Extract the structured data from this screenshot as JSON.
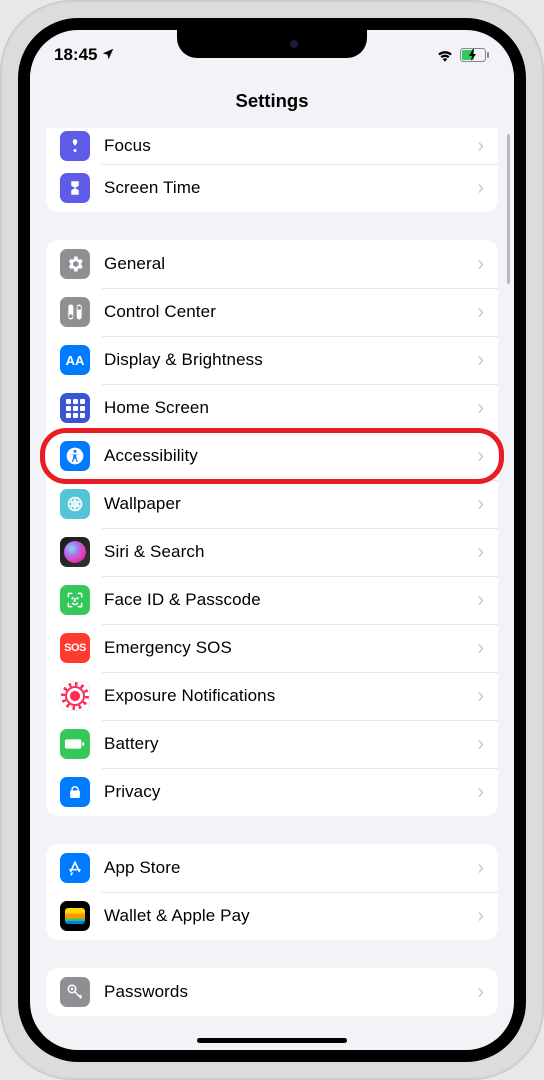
{
  "status": {
    "time": "18:45"
  },
  "header": {
    "title": "Settings"
  },
  "groups": [
    {
      "rows": [
        {
          "key": "focus",
          "label": "Focus",
          "icon": "focus-icon"
        },
        {
          "key": "screentime",
          "label": "Screen Time",
          "icon": "screen-time-icon"
        }
      ]
    },
    {
      "rows": [
        {
          "key": "general",
          "label": "General",
          "icon": "general-icon"
        },
        {
          "key": "controlcenter",
          "label": "Control Center",
          "icon": "control-center-icon"
        },
        {
          "key": "display",
          "label": "Display & Brightness",
          "icon": "display-brightness-icon"
        },
        {
          "key": "homescreen",
          "label": "Home Screen",
          "icon": "home-screen-icon"
        },
        {
          "key": "accessibility",
          "label": "Accessibility",
          "icon": "accessibility-icon",
          "highlighted": true
        },
        {
          "key": "wallpaper",
          "label": "Wallpaper",
          "icon": "wallpaper-icon"
        },
        {
          "key": "siri",
          "label": "Siri & Search",
          "icon": "siri-icon"
        },
        {
          "key": "faceid",
          "label": "Face ID & Passcode",
          "icon": "face-id-icon"
        },
        {
          "key": "sos",
          "label": "Emergency SOS",
          "icon": "sos-icon"
        },
        {
          "key": "exposure",
          "label": "Exposure Notifications",
          "icon": "exposure-notifications-icon"
        },
        {
          "key": "battery",
          "label": "Battery",
          "icon": "battery-icon"
        },
        {
          "key": "privacy",
          "label": "Privacy",
          "icon": "privacy-icon"
        }
      ]
    },
    {
      "rows": [
        {
          "key": "appstore",
          "label": "App Store",
          "icon": "app-store-icon"
        },
        {
          "key": "wallet",
          "label": "Wallet & Apple Pay",
          "icon": "wallet-icon"
        }
      ]
    },
    {
      "rows": [
        {
          "key": "passwords",
          "label": "Passwords",
          "icon": "passwords-icon"
        }
      ]
    }
  ],
  "sos_text": "SOS"
}
